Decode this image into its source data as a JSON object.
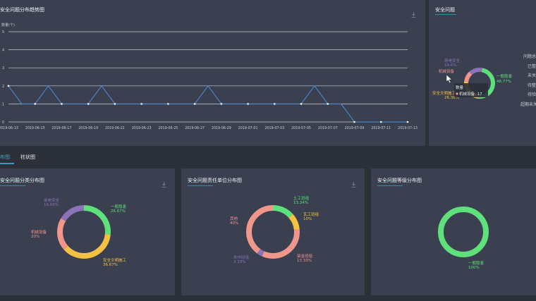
{
  "trend_panel": {
    "title": "安全问题分布趋势图",
    "y_label": "数量(个)"
  },
  "problems_panel": {
    "title": "安全问题",
    "legend": [
      "问题总",
      "已整",
      "未关",
      "待整",
      "待验",
      "超期未关"
    ],
    "tooltip": {
      "title": "数量",
      "item": "机械设备: 17"
    },
    "slices": [
      {
        "name": "一般隐患",
        "percent": "48.77%",
        "color": "#5ee07a"
      },
      {
        "name": "安全文明施工",
        "percent": "26.38%",
        "color": "#f4c242"
      },
      {
        "name": "机械设备",
        "percent": "",
        "color": "#f1968b"
      },
      {
        "name": "用电安全",
        "percent": "19.6%",
        "color": "#8c73b8"
      }
    ]
  },
  "tabs": [
    "布图",
    "柱状图"
  ],
  "category_panel": {
    "title": "安全问题分类分布图",
    "slices": [
      {
        "name": "一般隐患",
        "percent": "26.67%",
        "value": 26.67,
        "color": "#5ee07a"
      },
      {
        "name": "安全文明施工",
        "percent": "36.67%",
        "value": 36.67,
        "color": "#f4c242"
      },
      {
        "name": "机械设备",
        "percent": "20%",
        "value": 20,
        "color": "#f1968b"
      },
      {
        "name": "用电安全",
        "percent": "16.66%",
        "value": 16.66,
        "color": "#8c73b8"
      }
    ]
  },
  "unit_panel": {
    "title": "安全问题责任单位分布图",
    "slices": [
      {
        "name": "土工班组",
        "percent": "13.34%",
        "value": 13.34,
        "color": "#5ee07a"
      },
      {
        "name": "瓦工班组",
        "percent": "10%",
        "value": 10,
        "color": "#f4c242"
      },
      {
        "name": "架金班组",
        "percent": "13.33%",
        "value": 13.33,
        "color": "#f1968b"
      },
      {
        "name": "",
        "percent": "",
        "value": 20,
        "color": "#f1968b"
      },
      {
        "name": "木作班组",
        "percent": "3.33%",
        "value": 3.33,
        "color": "#8c73b8"
      },
      {
        "name": "其他",
        "percent": "40%",
        "value": 40,
        "color": "#f1968b"
      }
    ]
  },
  "level_panel": {
    "title": "安全问题等级分布图",
    "slices": [
      {
        "name": "一般隐患",
        "percent": "100%",
        "value": 100,
        "color": "#5ee07a"
      }
    ]
  },
  "chart_data": [
    {
      "type": "line",
      "title": "安全问题分布趋势图",
      "ylabel": "数量(个)",
      "ylim": [
        0,
        5
      ],
      "yticks": [
        0,
        1,
        2,
        3,
        4,
        5
      ],
      "x": [
        "2019-06-13",
        "2019-06-14",
        "2019-06-15",
        "2019-06-16",
        "2019-06-17",
        "2019-06-18",
        "2019-06-19",
        "2019-06-20",
        "2019-06-21",
        "2019-06-22",
        "2019-06-23",
        "2019-06-24",
        "2019-06-25",
        "2019-06-26",
        "2019-06-27",
        "2019-06-28",
        "2019-06-29",
        "2019-06-30",
        "2019-07-01",
        "2019-07-02",
        "2019-07-03",
        "2019-07-04",
        "2019-07-05",
        "2019-07-06",
        "2019-07-07",
        "2019-07-08",
        "2019-07-09",
        "2019-07-10",
        "2019-07-11",
        "2019-07-12",
        "2019-07-13"
      ],
      "xticks": [
        "2019-06-13",
        "2019-06-15",
        "2019-06-17",
        "2019-06-19",
        "2019-06-21",
        "2019-06-23",
        "2019-06-25",
        "2019-06-27",
        "2019-06-29",
        "2019-07-01",
        "2019-07-03",
        "2019-07-05",
        "2019-07-07",
        "2019-07-09",
        "2019-07-11",
        "2019-07-13"
      ],
      "series": [
        {
          "values": [
            2,
            1,
            1,
            2,
            1,
            1,
            1,
            2,
            1,
            1,
            1,
            1,
            1,
            1,
            1,
            2,
            1,
            1,
            1,
            1,
            1,
            1,
            1,
            2,
            1,
            1,
            0,
            0,
            0,
            0,
            0
          ]
        }
      ],
      "grid": true
    }
  ],
  "colors": {
    "accent": "#2f8fa8",
    "line": "#4a8fe0",
    "grid": "#c8ccd4"
  }
}
